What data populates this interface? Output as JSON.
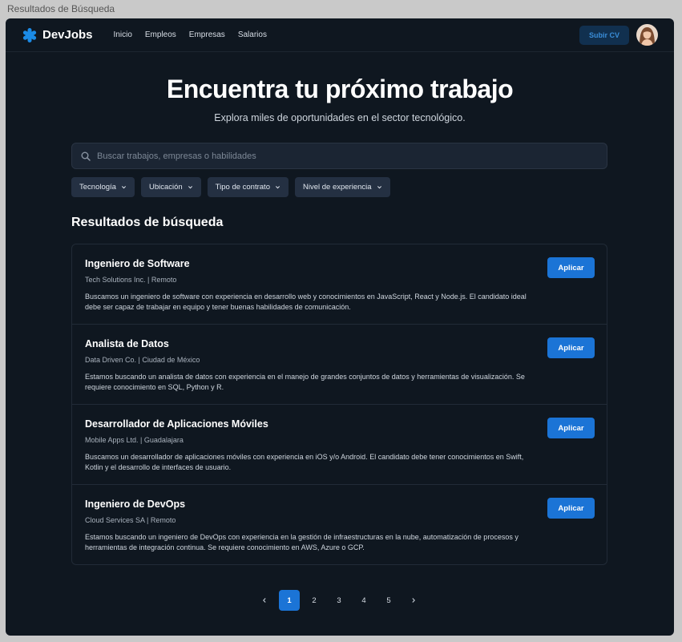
{
  "window": {
    "title": "Resultados de Búsqueda"
  },
  "nav": {
    "brand": "DevJobs",
    "links": [
      "Inicio",
      "Empleos",
      "Empresas",
      "Salarios"
    ],
    "cv_button": "Subir CV"
  },
  "hero": {
    "title": "Encuentra tu próximo trabajo",
    "subtitle": "Explora miles de oportunidades en el sector tecnológico."
  },
  "search": {
    "placeholder": "Buscar trabajos, empresas o habilidades"
  },
  "filters": [
    "Tecnología",
    "Ubicación",
    "Tipo de contrato",
    "Nivel de experiencia"
  ],
  "results": {
    "heading": "Resultados de búsqueda",
    "apply_label": "Aplicar",
    "jobs": [
      {
        "title": "Ingeniero de Software",
        "company": "Tech Solutions Inc.",
        "location": "Remoto",
        "description": "Buscamos un ingeniero de software con experiencia en desarrollo web y conocimientos en JavaScript, React y Node.js. El candidato ideal debe ser capaz de trabajar en equipo y tener buenas habilidades de comunicación."
      },
      {
        "title": "Analista de Datos",
        "company": "Data Driven Co.",
        "location": "Ciudad de México",
        "description": "Estamos buscando un analista de datos con experiencia en el manejo de grandes conjuntos de datos y herramientas de visualización. Se requiere conocimiento en SQL, Python y R."
      },
      {
        "title": "Desarrollador de Aplicaciones Móviles",
        "company": "Mobile Apps Ltd.",
        "location": "Guadalajara",
        "description": "Buscamos un desarrollador de aplicaciones móviles con experiencia en iOS y/o Android. El candidato debe tener conocimientos en Swift, Kotlin y el desarrollo de interfaces de usuario."
      },
      {
        "title": "Ingeniero de DevOps",
        "company": "Cloud Services SA",
        "location": "Remoto",
        "description": "Estamos buscando un ingeniero de DevOps con experiencia en la gestión de infraestructuras en la nube, automatización de procesos y herramientas de integración continua. Se requiere conocimiento en AWS, Azure o GCP."
      }
    ]
  },
  "pagination": {
    "pages": [
      "1",
      "2",
      "3",
      "4",
      "5"
    ],
    "current": "1"
  },
  "colors": {
    "accent": "#1b74d6",
    "background": "#0f1720"
  },
  "icons": {
    "logo": "asterisk-icon",
    "search": "search-icon",
    "chevron": "chevron-down-icon"
  }
}
